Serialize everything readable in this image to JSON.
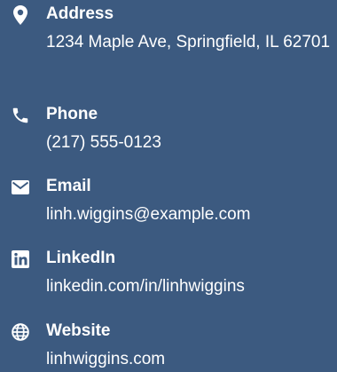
{
  "contact": {
    "address": {
      "icon": "map-pin-icon",
      "label": "Address",
      "value": "1234 Maple Ave, Springfield, IL 62701"
    },
    "phone": {
      "icon": "phone-icon",
      "label": "Phone",
      "value": "(217) 555-0123"
    },
    "email": {
      "icon": "envelope-icon",
      "label": "Email",
      "value": "linh.wiggins@example.com"
    },
    "linkedin": {
      "icon": "linkedin-icon",
      "label": "LinkedIn",
      "value": "linkedin.com/in/linhwiggins"
    },
    "website": {
      "icon": "globe-icon",
      "label": "Website",
      "value": "linhwiggins.com"
    }
  },
  "colors": {
    "background": "#3c5a80",
    "text": "#ffffff"
  }
}
